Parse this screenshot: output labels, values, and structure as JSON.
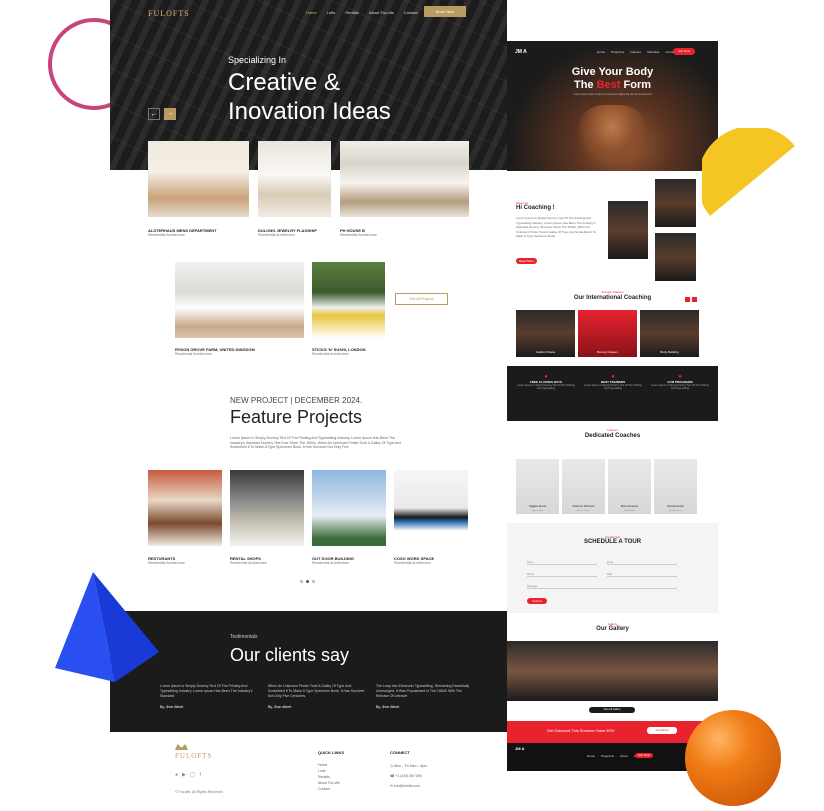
{
  "left_site": {
    "logo": "FULOFTS",
    "nav": [
      "Home",
      "Lofts",
      "Rentals",
      "About FuLofts",
      "Contact"
    ],
    "cta": "Book Now",
    "hero": {
      "subtitle": "Specializing In",
      "title_line1": "Creative &",
      "title_line2": "Inovation Ideas"
    },
    "projects": [
      {
        "title": "ALSTERHAUS MENS DEPARTMENT",
        "type": "Residential Architecture"
      },
      {
        "title": "DULONG JEWELRY FLAGSHIP",
        "type": "Residential Architecture"
      },
      {
        "title": "PH HOUSE B",
        "type": "Residential Architecture"
      },
      {
        "title": "RYDON GROVE FARM, UNITED KINGDOM",
        "type": "Residential Architecture"
      },
      {
        "title": "STICKS 'N' SUSHI, LONDON",
        "type": "Residential Architecture"
      }
    ],
    "see_all": "See All Projects",
    "feature": {
      "kicker": "NEW PROJECT | DECEMBER 2024.",
      "title": "Feature Projects",
      "body": "Lorem Ipsum Is Simply Dummy Text Of The Printing And Typesetting Industry. Lorem Ipsum Has Been The Industry's Standard Dummy Text Ever Since The 1500s, When An Unknown Printer Took A Galley Of Type And Scrambled It To Make A Type Specimen Book. It Has Survived Not Only Five",
      "items": [
        {
          "title": "RESTURANTS",
          "type": "Residential Architecture"
        },
        {
          "title": "RENTAL SHOPS",
          "type": "Residential Architecture"
        },
        {
          "title": "OUT DOOR BUILDING",
          "type": "Residential Architecture"
        },
        {
          "title": "COSO WORK SPACE",
          "type": "Residential Architecture"
        }
      ]
    },
    "testimonials": {
      "kicker": "Testimonials",
      "title": "Our clients say",
      "quotes": [
        {
          "text": "Lorem Ipsum Is Simply Dummy Text Of The Printing And Typesetting Industry. Lorem Ipsum Has Been The Industry's Standard",
          "name": "By, Jhon Albert"
        },
        {
          "text": "When An Unknown Printer Took A Galley Of Type And Scrambled It To Make A Type Specimen Book. It Has Survived Not Only Five Centuries.",
          "name": "By, Jhon Albert"
        },
        {
          "text": "The Leap Into Electronic Typesetting, Remaining Essentially Unchanged. It Was Popularised In The 1960S With The Release Of Letraset",
          "name": "By, Jhon Albert"
        }
      ]
    },
    "footer": {
      "logo": "FULOFTS",
      "copyright": "© FuLofts. All Rights Reserved",
      "quick_links_title": "QUICK LINKS",
      "quick_links": [
        "Home",
        "Lofts",
        "Rentals",
        "About FuLofts",
        "Contact"
      ],
      "connect_title": "CONNECT",
      "connect": [
        "Mon – Fri 9am – 6pm",
        "+1 (234) 567 890",
        "info@fulofts.com"
      ]
    }
  },
  "right_site": {
    "logo": "JM A",
    "nav": [
      "Home",
      "Programs",
      "Trainers",
      "Schedule",
      "Contact"
    ],
    "join": "Join Now",
    "hero": {
      "line1": "Give Your Body",
      "line2_pre": "The ",
      "line2_accent": "Best",
      "line2_post": " Form",
      "sub": "Lorem ipsum dolor sit amet consectetur adipiscing elit sed do eiusmod"
    },
    "about": {
      "kicker": "About Us",
      "title": "Hi Coaching !",
      "body": "Lorem Ipsum Is Simply Dummy Text Of The Printing And Typesetting Industry. Lorem Ipsum Has Been The Industry's Standard Dummy Text Ever Since The 1500s, When An Unknown Printer Took A Galley Of Type And Scrambled It To Make A Type Specimen Book.",
      "button": "Read More"
    },
    "coaching": {
      "kicker": "Popular Classes",
      "title": "Our International Coaching",
      "items": [
        "Cardio Fitness",
        "Boxing Classes",
        "Body Building"
      ]
    },
    "features": [
      {
        "title": "FREE CLASSES DAYS",
        "text": "Lorem Ipsum Is Simply Dummy Text Of The Printing And Typesetting"
      },
      {
        "title": "BEST TRAINERS",
        "text": "Lorem Ipsum Is Simply Dummy Text Of The Printing And Typesetting"
      },
      {
        "title": "GYM PROGRAMS",
        "text": "Lorem Ipsum Is Simply Dummy Text Of The Printing And Typesetting"
      }
    ],
    "coaches": {
      "kicker": "Trainers",
      "title": "Dedicated Coaches",
      "people": [
        {
          "name": "Olggelin Emma",
          "role": "Yoga Trainer"
        },
        {
          "name": "Katherine Robinson",
          "role": "Fitness Trainer"
        },
        {
          "name": "Bryan Emerson",
          "role": "Body Builder"
        },
        {
          "name": "Hannah Ermas",
          "role": "Zumba Trainer"
        }
      ]
    },
    "tour": {
      "kicker": "Contact Us",
      "title": "SCHEDULE A TOUR",
      "fields": [
        "Name",
        "Email",
        "Phone",
        "Date",
        "Message"
      ],
      "button": "Submit"
    },
    "gallery": {
      "kicker": "Gallery",
      "title": "Our Gallery",
      "button": "View All Gallery"
    },
    "banner": {
      "text": "Get Discount This Summer Save 50%",
      "button": "Get Started"
    },
    "footer": {
      "logo": "JM A",
      "nav": [
        "Home",
        "Programs",
        "About",
        "Contact"
      ],
      "join": "Join Now"
    }
  },
  "colors": {
    "gold": "#b69c63",
    "red": "#e8232e",
    "dark": "#1b1b1b",
    "ring": "#c8447a",
    "blue": "#2a4ff0",
    "yellow": "#f5c623",
    "orange": "#f07b15"
  }
}
